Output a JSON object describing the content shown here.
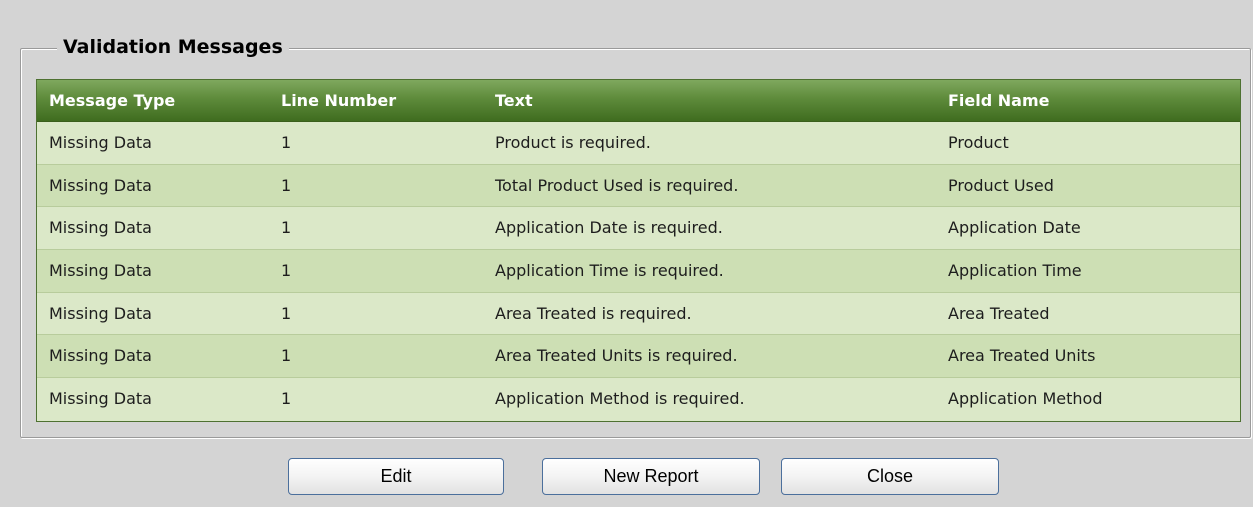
{
  "panel": {
    "title": "Validation Messages"
  },
  "table": {
    "columns": [
      "Message Type",
      "Line Number",
      "Text",
      "Field Name"
    ],
    "rows": [
      [
        "Missing Data",
        "1",
        "Product is required.",
        "Product"
      ],
      [
        "Missing Data",
        "1",
        "Total Product Used is required.",
        "Product Used"
      ],
      [
        "Missing Data",
        "1",
        "Application Date is required.",
        "Application Date"
      ],
      [
        "Missing Data",
        "1",
        "Application Time is required.",
        "Application Time"
      ],
      [
        "Missing Data",
        "1",
        "Area Treated is required.",
        "Area Treated"
      ],
      [
        "Missing Data",
        "1",
        "Area Treated Units is required.",
        "Area Treated Units"
      ],
      [
        "Missing Data",
        "1",
        "Application Method is required.",
        "Application Method"
      ]
    ]
  },
  "buttons": {
    "edit": "Edit",
    "new_report": "New Report",
    "close": "Close"
  },
  "colors": {
    "header_green": "#5e8b3b",
    "row_light": "#dbe8c8",
    "row_dark": "#cddfb4",
    "button_border": "#4b6f9c"
  }
}
